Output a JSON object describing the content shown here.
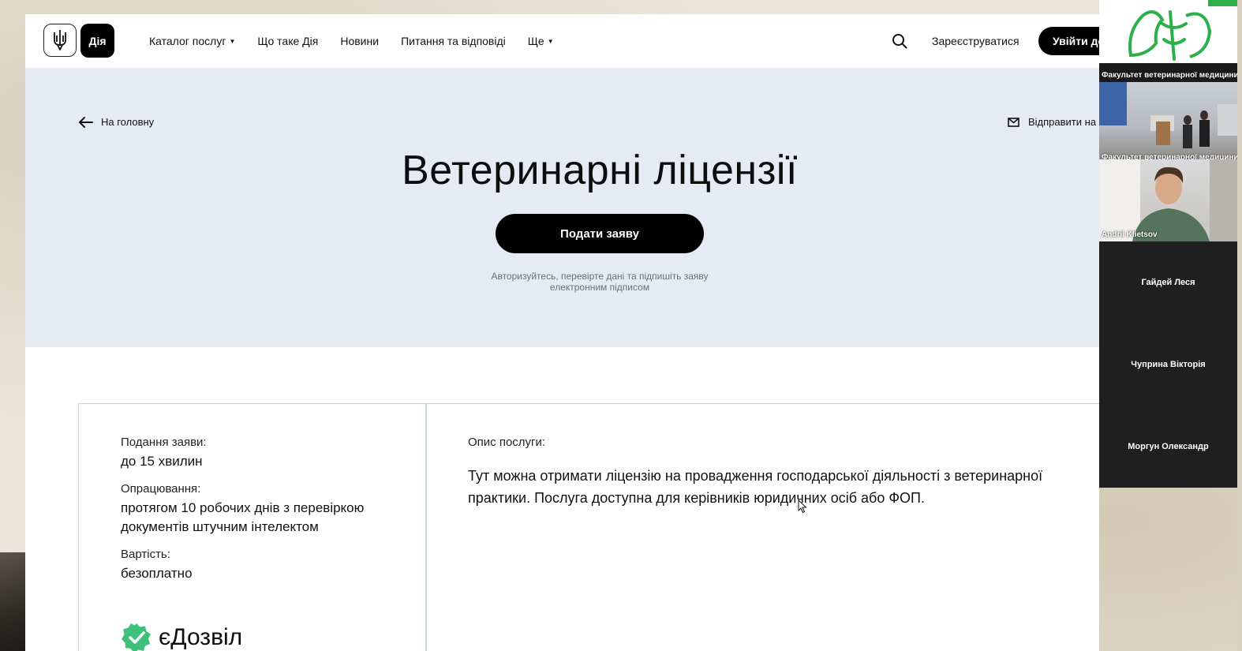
{
  "header": {
    "logo_text": "Дія",
    "nav": [
      {
        "label": "Каталог послуг",
        "has_caret": true
      },
      {
        "label": "Що таке Дія",
        "has_caret": false
      },
      {
        "label": "Новини",
        "has_caret": false
      },
      {
        "label": "Питання та відповіді",
        "has_caret": false
      },
      {
        "label": "Ще",
        "has_caret": true
      }
    ],
    "register_label": "Зареєструватися",
    "login_label": "Увійти до"
  },
  "hero": {
    "back_label": "На головну",
    "send_label": "Відправити на",
    "title": "Ветеринарні ліцензії",
    "apply_label": "Подати заяву",
    "hint": "Авторизуйтесь, перевірте дані та підпишіть заяву електронним підписом"
  },
  "card": {
    "info": [
      {
        "label": "Подання заяви:",
        "value": "до 15 хвилин"
      },
      {
        "label": "Опрацювання:",
        "value": "протягом 10 робочих днів з перевіркою документів штучним інтелектом"
      },
      {
        "label": "Вартість:",
        "value": "безоплатно"
      }
    ],
    "brand": "єДозвіл",
    "description_label": "Опис послуги:",
    "description": "Тут можна отримати ліцензію на провадження господарської діяльності з ветеринарної практики. Послуга доступна для керівників юридичних осіб або ФОП."
  },
  "video": {
    "participants": [
      {
        "name": "Факультет ветеринарної медицини",
        "type": "logo"
      },
      {
        "name": "Факультет ветеринарної медицини",
        "type": "room"
      },
      {
        "name": "Andrii Klietsov",
        "type": "person"
      },
      {
        "name": "Гайдей Леся",
        "type": "audio"
      },
      {
        "name": "Чуприна Вікторія",
        "type": "audio"
      },
      {
        "name": "Моргун Олександр",
        "type": "audio"
      }
    ]
  },
  "colors": {
    "accent": "#000000",
    "hero_bg": "#e6ebf3",
    "card_border": "#b9dcd7",
    "edozvil_green": "#3fc07a"
  }
}
